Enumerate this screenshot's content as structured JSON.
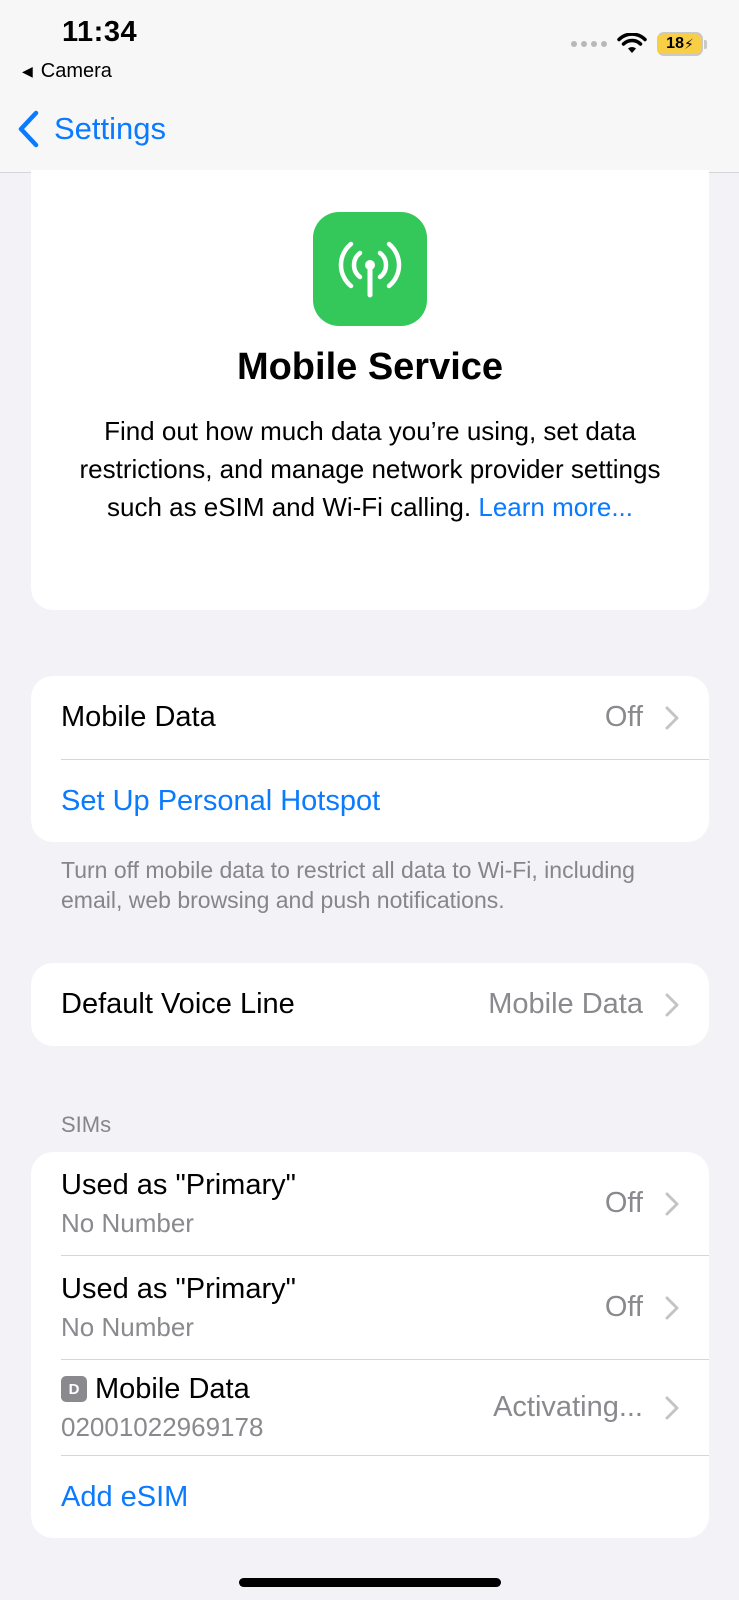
{
  "status_bar": {
    "time": "11:34",
    "back_app": "Camera",
    "battery": "18"
  },
  "nav": {
    "back_label": "Settings"
  },
  "hero": {
    "icon": "antenna-icon",
    "title": "Mobile Service",
    "description": "Find out how much data you’re using, set data restrictions, and manage network provider settings such as eSIM and Wi-Fi calling.",
    "learn_more": "Learn more..."
  },
  "data_section": {
    "mobile_data_label": "Mobile Data",
    "mobile_data_value": "Off",
    "hotspot_label": "Set Up Personal Hotspot",
    "footer": "Turn off mobile data to restrict all data to Wi-Fi, including email, web browsing and push notifications."
  },
  "voice_section": {
    "label": "Default Voice Line",
    "value": "Mobile Data"
  },
  "sims_section": {
    "header": "SIMs",
    "items": [
      {
        "label": "Used as \"Primary\"",
        "sub": "No Number",
        "value": "Off"
      },
      {
        "label": "Used as \"Primary\"",
        "sub": "No Number",
        "value": "Off"
      },
      {
        "badge": "D",
        "label": "Mobile Data",
        "sub": "02001022969178",
        "value": "Activating..."
      }
    ],
    "add_esim": "Add eSIM"
  },
  "colors": {
    "accent": "#0a7aff",
    "icon_green": "#34c759",
    "background": "#f2f2f7"
  }
}
